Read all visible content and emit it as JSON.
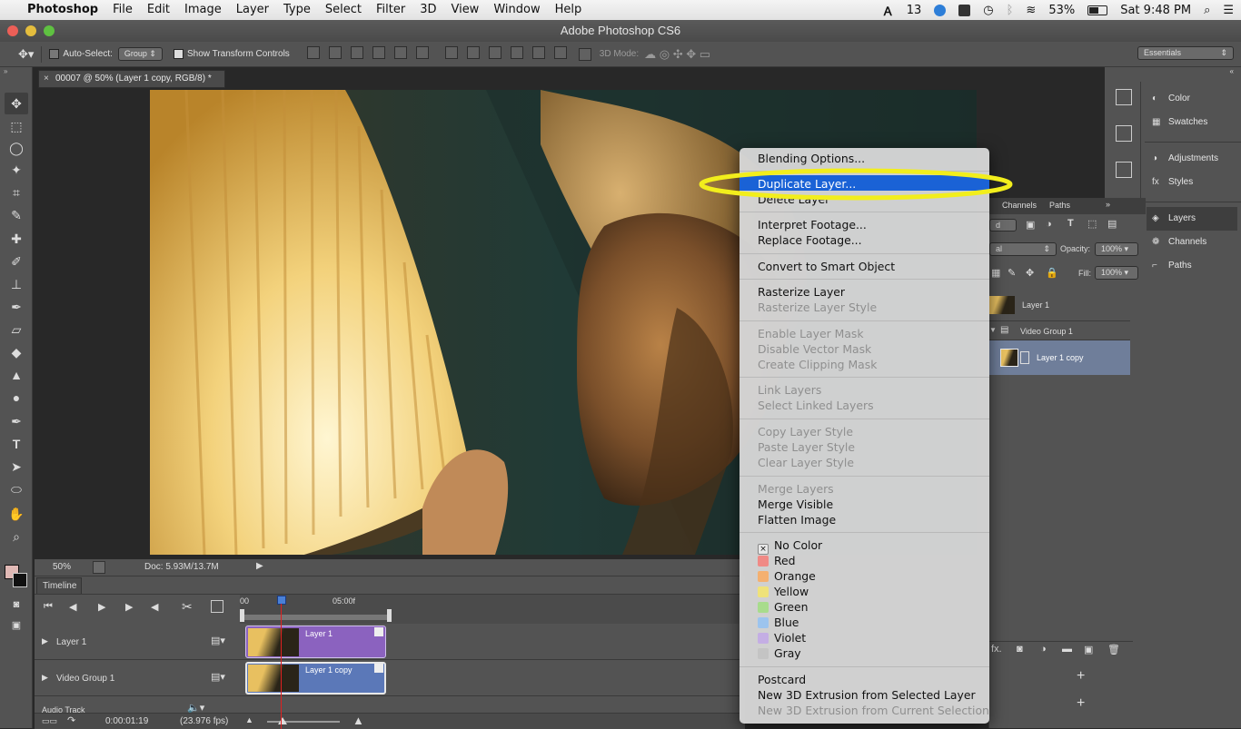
{
  "menubar": {
    "apple": "",
    "app": "Photoshop",
    "items": [
      "File",
      "Edit",
      "Image",
      "Layer",
      "Type",
      "Select",
      "Filter",
      "3D",
      "View",
      "Window",
      "Help"
    ],
    "status": {
      "notif": "13",
      "battery": "53%",
      "clock": "Sat 9:48 PM"
    }
  },
  "window": {
    "title": "Adobe Photoshop CS6"
  },
  "options": {
    "auto_select": "Auto-Select:",
    "auto_select_value": "Group",
    "show_transform": "Show Transform Controls",
    "mode_3d": "3D Mode:",
    "workspace": "Essentials"
  },
  "document": {
    "tab": "00007 @ 50% (Layer 1 copy, RGB/8) *"
  },
  "status": {
    "zoom": "50%",
    "doc": "Doc: 5.93M/13.7M"
  },
  "timeline": {
    "title": "Timeline",
    "time_start": "00",
    "time_mark": "05:00f",
    "tracks": [
      {
        "label": "Layer 1",
        "clip": "Layer 1",
        "color": "#8b62bf"
      },
      {
        "label": "Video Group 1",
        "clip": "Layer 1 copy",
        "color": "#5b78b8"
      },
      {
        "label": "Audio Track"
      }
    ],
    "timecode": "0:00:01:19",
    "fps": "(23.976 fps)"
  },
  "right_panels": {
    "group1": [
      "Color",
      "Swatches"
    ],
    "group2": [
      "Adjustments",
      "Styles"
    ],
    "group3": [
      "Layers",
      "Channels",
      "Paths"
    ]
  },
  "layers": {
    "tabs": [
      "Channels",
      "Paths"
    ],
    "kind": "d",
    "blend": "al",
    "opacity_label": "Opacity:",
    "opacity": "100%",
    "fill_label": "Fill:",
    "fill": "100%",
    "rows": [
      "Layer 1",
      "Video Group 1",
      "Layer 1 copy"
    ]
  },
  "context_menu": {
    "items": [
      {
        "label": "Blending Options...",
        "enabled": true
      },
      {
        "label": "Duplicate Layer...",
        "enabled": true,
        "highlighted": true
      },
      {
        "label": "Delete Layer",
        "enabled": true
      },
      {
        "label": "Interpret Footage...",
        "enabled": true
      },
      {
        "label": "Replace Footage...",
        "enabled": true
      },
      {
        "label": "Convert to Smart Object",
        "enabled": true
      },
      {
        "label": "Rasterize Layer",
        "enabled": true
      },
      {
        "label": "Rasterize Layer Style",
        "enabled": false
      },
      {
        "label": "Enable Layer Mask",
        "enabled": false
      },
      {
        "label": "Disable Vector Mask",
        "enabled": false
      },
      {
        "label": "Create Clipping Mask",
        "enabled": false
      },
      {
        "label": "Link Layers",
        "enabled": false
      },
      {
        "label": "Select Linked Layers",
        "enabled": false
      },
      {
        "label": "Copy Layer Style",
        "enabled": false
      },
      {
        "label": "Paste Layer Style",
        "enabled": false
      },
      {
        "label": "Clear Layer Style",
        "enabled": false
      },
      {
        "label": "Merge Layers",
        "enabled": false
      },
      {
        "label": "Merge Visible",
        "enabled": true
      },
      {
        "label": "Flatten Image",
        "enabled": true
      },
      {
        "label": "No Color",
        "enabled": true,
        "swatch": "none"
      },
      {
        "label": "Red",
        "enabled": true,
        "swatch": "#f08a86"
      },
      {
        "label": "Orange",
        "enabled": true,
        "swatch": "#f4b070"
      },
      {
        "label": "Yellow",
        "enabled": true,
        "swatch": "#efe27a"
      },
      {
        "label": "Green",
        "enabled": true,
        "swatch": "#a8dc8c"
      },
      {
        "label": "Blue",
        "enabled": true,
        "swatch": "#9cc4ee"
      },
      {
        "label": "Violet",
        "enabled": true,
        "swatch": "#c4aee4"
      },
      {
        "label": "Gray",
        "enabled": true,
        "swatch": "#c4c4c4"
      },
      {
        "label": "Postcard",
        "enabled": true
      },
      {
        "label": "New 3D Extrusion from Selected Layer",
        "enabled": true
      },
      {
        "label": "New 3D Extrusion from Current Selection",
        "enabled": false
      }
    ]
  },
  "colors": {
    "highlight": "#1a62d6",
    "annotation_ellipse": "#f2ee1c",
    "playhead": "#e02020"
  }
}
